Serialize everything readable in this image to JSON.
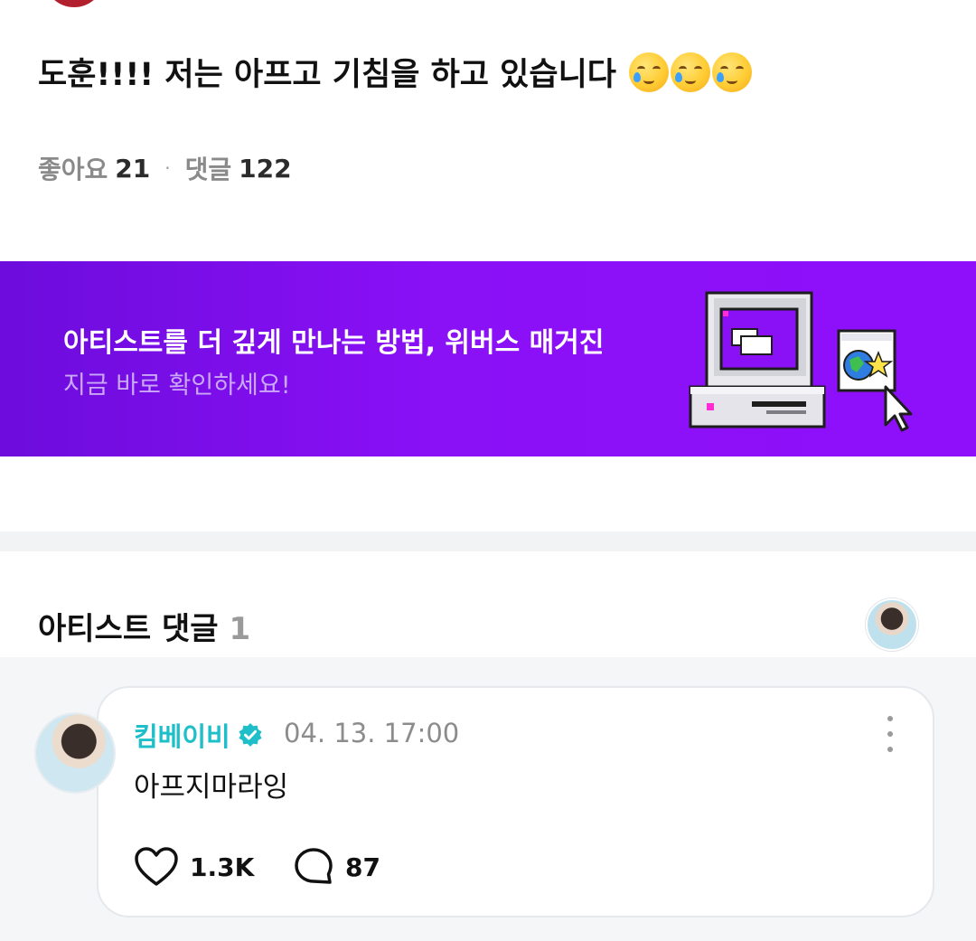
{
  "post": {
    "text": "도훈!!!! 저는 아프고 기침을 하고 있습니다",
    "emojis": [
      "crying-face-emoji",
      "crying-face-emoji",
      "crying-face-emoji"
    ],
    "likes_label": "좋아요",
    "likes_count": "21",
    "separator": "·",
    "comments_label": "댓글",
    "comments_count": "122"
  },
  "banner": {
    "title": "아티스트를 더 깊게 만나는 방법, 위버스 매거진",
    "subtitle": "지금 바로 확인하세요!",
    "background_color": "#8a10f6"
  },
  "artist_comments": {
    "title": "아티스트 댓글",
    "count": "1",
    "comment": {
      "author": "킴베이비",
      "verified": true,
      "timestamp": "04. 13. 17:00",
      "text": "아프지마라잉",
      "like_count": "1.3K",
      "reply_count": "87"
    }
  },
  "colors": {
    "accent": "#1fbfc9",
    "banner_purple": "#8a10f6",
    "muted_text": "#8a8a8a"
  }
}
